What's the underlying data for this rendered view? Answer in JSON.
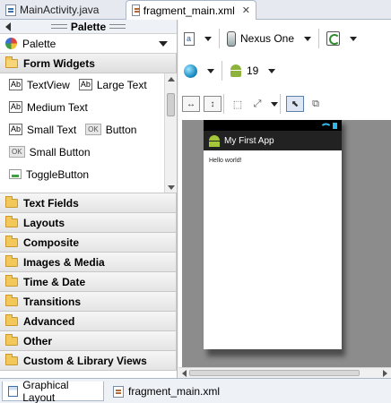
{
  "editor_tabs": [
    {
      "label": "MainActivity.java",
      "icon": "java-file-icon"
    },
    {
      "label": "fragment_main.xml",
      "icon": "xml-file-icon",
      "close": "✕"
    }
  ],
  "palette": {
    "header": "Palette",
    "selector_value": "Palette",
    "open_category": "Form Widgets",
    "widgets": {
      "textview": "TextView",
      "large_text": "Large Text",
      "medium_text": "Medium Text",
      "small_text": "Small Text",
      "button": "Button",
      "small_button": "Small Button",
      "toggle_button": "ToggleButton",
      "ab_badge": "Ab",
      "ok_badge": "OK"
    },
    "categories": [
      "Text Fields",
      "Layouts",
      "Composite",
      "Images & Media",
      "Time & Date",
      "Transitions",
      "Advanced",
      "Other",
      "Custom & Library Views"
    ]
  },
  "toolbar": {
    "device": "Nexus One",
    "api_level": "19"
  },
  "preview": {
    "app_title": "My First App",
    "body_text": "Hello world!"
  },
  "bottom_tabs": [
    {
      "label": "Graphical Layout"
    },
    {
      "label": "fragment_main.xml"
    }
  ],
  "colors": {
    "canvas_bg": "#8c8c8c",
    "action_bar": "#222222",
    "status_accent": "#33b5e5",
    "android_green": "#a4c639"
  }
}
